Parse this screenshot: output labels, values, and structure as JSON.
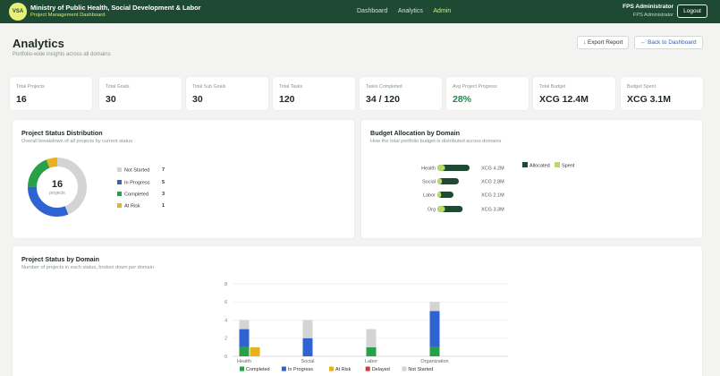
{
  "header": {
    "logo_text": "VSA",
    "org_name": "Ministry of Public Health, Social Development & Labor",
    "org_sub": "Project Management Dashboard",
    "nav": [
      {
        "label": "Dashboard",
        "active": false
      },
      {
        "label": "Analytics",
        "active": false
      },
      {
        "label": "Admin",
        "active": true
      }
    ],
    "user_name": "FPS Administrator",
    "user_role": "FPS Administrator",
    "logout_label": "Logout"
  },
  "page": {
    "title": "Analytics",
    "subtitle": "Portfolio-wide insights across all domains",
    "export_label": "↓ Export Report",
    "back_label": "← Back to Dashboard"
  },
  "kpis": [
    {
      "label": "Total Projects",
      "value": "16"
    },
    {
      "label": "Total Goals",
      "value": "30"
    },
    {
      "label": "Total Sub Goals",
      "value": "30"
    },
    {
      "label": "Total Tasks",
      "value": "120"
    },
    {
      "label": "Tasks Completed",
      "value": "34 / 120"
    },
    {
      "label": "Avg Project Progress",
      "value": "28%"
    },
    {
      "label": "Total Budget",
      "value": "XCG 12.4M"
    },
    {
      "label": "Budget Spent",
      "value": "XCG 3.1M"
    }
  ],
  "status_panel": {
    "title": "Project Status Distribution",
    "subtitle": "Overall breakdown of all projects by current status",
    "center_value": "16",
    "center_label": "projects",
    "items": [
      {
        "label": "Not Started",
        "count": "7",
        "value": 7,
        "color": "#d4d4d4"
      },
      {
        "label": "In Progress",
        "count": "5",
        "value": 5,
        "color": "#2f63d1"
      },
      {
        "label": "Completed",
        "count": "3",
        "value": 3,
        "color": "#27a048"
      },
      {
        "label": "At Risk",
        "count": "1",
        "value": 1,
        "color": "#e6b21e"
      }
    ]
  },
  "budget_panel": {
    "title": "Budget Allocation by Domain",
    "subtitle": "How the total portfolio budget is distributed across domains",
    "legend": [
      {
        "label": "Allocated",
        "color": "#1e4a34"
      },
      {
        "label": "Spent",
        "color": "#b9d96a"
      }
    ]
  },
  "domain_panel": {
    "title": "Project Status by Domain",
    "subtitle": "Number of projects in each status, broken down per domain"
  },
  "chart_data": [
    {
      "type": "pie",
      "categories": [
        "Not Started",
        "In Progress",
        "Completed",
        "At Risk"
      ],
      "values": [
        7,
        5,
        3,
        1
      ],
      "title": "Project Status Distribution"
    },
    {
      "type": "bar",
      "orientation": "horizontal",
      "title": "Budget Allocation by Domain",
      "categories": [
        "Health",
        "Social",
        "Labor",
        "Org"
      ],
      "value_labels": [
        "XCG 4.2M",
        "XCG 2.8M",
        "XCG 2.1M",
        "XCG 3.3M"
      ],
      "series": [
        {
          "name": "Allocated",
          "values": [
            4.2,
            2.8,
            2.1,
            3.3
          ]
        },
        {
          "name": "Spent",
          "values": [
            1.0,
            0.6,
            0.5,
            1.0
          ]
        }
      ],
      "xlim": [
        0,
        4.2
      ],
      "legend": "right"
    },
    {
      "type": "bar",
      "stacked": true,
      "title": "Project Status by Domain",
      "categories": [
        "Health",
        "Social",
        "Labor",
        "Organization"
      ],
      "series": [
        {
          "name": "Completed",
          "color": "#27a048",
          "values": [
            1,
            0,
            1,
            1
          ]
        },
        {
          "name": "In Progress",
          "color": "#2f63d1",
          "values": [
            2,
            2,
            0,
            4
          ]
        },
        {
          "name": "At Risk",
          "color": "#e6b21e",
          "values": [
            1,
            0,
            0,
            0
          ]
        },
        {
          "name": "Delayed",
          "color": "#d23a33",
          "values": [
            0,
            0,
            0,
            0
          ]
        },
        {
          "name": "Not Started",
          "color": "#d4d4d4",
          "values": [
            1,
            2,
            2,
            1
          ]
        }
      ],
      "yticks": [
        "0",
        "2",
        "4",
        "6",
        "8"
      ],
      "ylim": [
        0,
        8
      ],
      "grid": true,
      "legend": "bottom"
    }
  ]
}
